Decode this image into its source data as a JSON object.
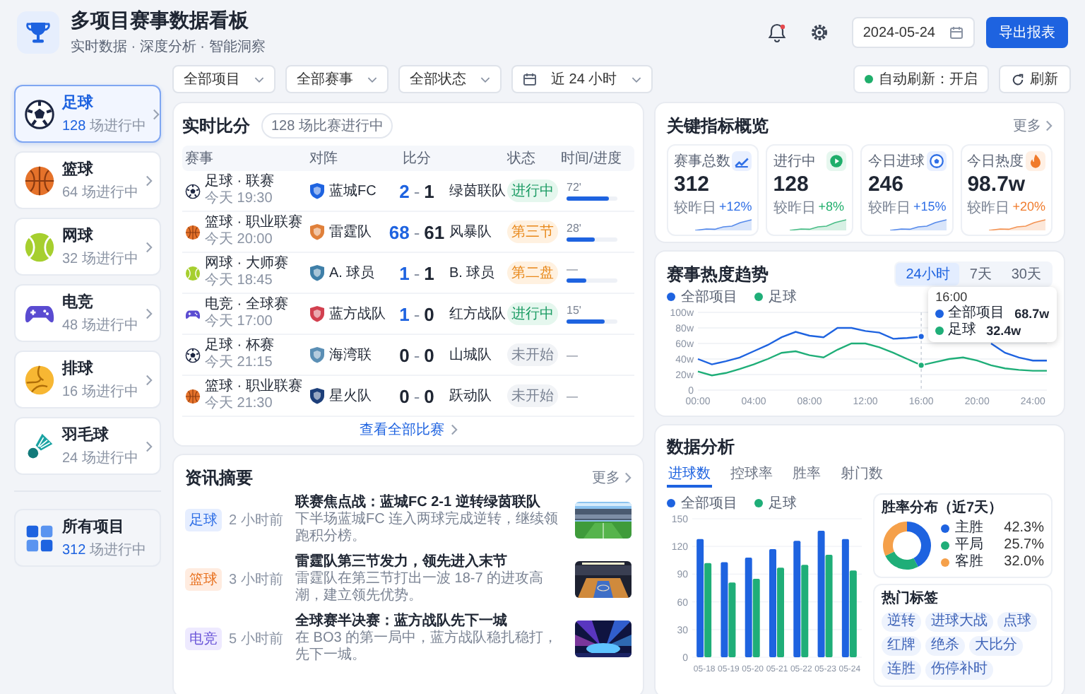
{
  "header": {
    "title": "多项目赛事数据看板",
    "subtitle": "实时数据 · 深度分析 · 智能洞察",
    "date": "2024-05-24",
    "export_button": "导出报表"
  },
  "filters": [
    {
      "label": "全部项目",
      "kind": "select"
    },
    {
      "label": "全部赛事",
      "kind": "select"
    },
    {
      "label": "全部状态",
      "kind": "select"
    },
    {
      "label": "近 24 小时",
      "kind": "date"
    }
  ],
  "auto_refresh": {
    "label": "自动刷新：开启",
    "on": true
  },
  "refresh_button": "刷新",
  "sports": [
    {
      "name": "足球",
      "count": "128",
      "suffix": "场进行中",
      "kind": "football",
      "selected": true
    },
    {
      "name": "篮球",
      "count": "64",
      "suffix": "场进行中",
      "kind": "basketball",
      "selected": false
    },
    {
      "name": "网球",
      "count": "32",
      "suffix": "场进行中",
      "kind": "tennis",
      "selected": false
    },
    {
      "name": "电竞",
      "count": "48",
      "suffix": "场进行中",
      "kind": "esports",
      "selected": false
    },
    {
      "name": "排球",
      "count": "16",
      "suffix": "场进行中",
      "kind": "volleyball",
      "selected": false
    },
    {
      "name": "羽毛球",
      "count": "24",
      "suffix": "场进行中",
      "kind": "badminton",
      "selected": false
    }
  ],
  "all_sports": {
    "name": "所有项目",
    "count": "312",
    "suffix": "场进行中"
  },
  "live": {
    "title": "实时比分",
    "badge": "128 场比赛进行中",
    "columns": [
      "赛事",
      "对阵",
      "比分",
      "状态",
      "时间/进度"
    ],
    "rows": [
      {
        "kind": "football",
        "competition": "足球 · 联赛",
        "time": "今天 19:30",
        "home": {
          "name": "蓝城FC",
          "color": "#1e63e0"
        },
        "home_score": "2",
        "separator": "-",
        "away_score": "1",
        "away": "绿茵联队",
        "status": {
          "label": "进行中",
          "kind": "live"
        },
        "progress": "72'",
        "level": 0.82
      },
      {
        "kind": "basketball",
        "competition": "篮球 · 职业联赛",
        "time": "今天 20:00",
        "home": {
          "name": "雷霆队",
          "color": "#e0803a"
        },
        "home_score": "68",
        "separator": "-",
        "away_score": "61",
        "away": "风暴队",
        "status": {
          "label": "第三节",
          "kind": "period"
        },
        "progress": "28'",
        "level": 0.55
      },
      {
        "kind": "tennis",
        "competition": "网球 · 大师赛",
        "time": "今天 18:45",
        "home": {
          "name": "A. 球员",
          "color": "#3f7fa8"
        },
        "home_score": "1",
        "separator": "-",
        "away_score": "1",
        "away": "B. 球员",
        "status": {
          "label": "第二盘",
          "kind": "period"
        },
        "progress": "—",
        "level": 0.38
      },
      {
        "kind": "esports",
        "competition": "电竞 · 全球赛",
        "time": "今天 17:00",
        "home": {
          "name": "蓝方战队",
          "color": "#d2404f"
        },
        "home_score": "1",
        "separator": "-",
        "away_score": "0",
        "away": "红方战队",
        "status": {
          "label": "进行中",
          "kind": "live"
        },
        "progress": "15'",
        "level": 0.75
      },
      {
        "kind": "football",
        "competition": "足球 · 杯赛",
        "time": "今天 21:15",
        "home": {
          "name": "海湾联",
          "color": "#5b8fb5"
        },
        "home_score": "0",
        "separator": "-",
        "away_score": "0",
        "away": "山城队",
        "status": {
          "label": "未开始",
          "kind": "upcoming"
        },
        "progress": "—"
      },
      {
        "kind": "basketball",
        "competition": "篮球 · 职业联赛",
        "time": "今天 21:30",
        "home": {
          "name": "星火队",
          "color": "#1d3f7a"
        },
        "home_score": "0",
        "separator": "-",
        "away_score": "0",
        "away": "跃动队",
        "status": {
          "label": "未开始",
          "kind": "upcoming"
        },
        "progress": "—"
      }
    ],
    "view_all": "查看全部比赛"
  },
  "news": {
    "title": "资讯摘要",
    "more": "更多",
    "items": [
      {
        "tag": "足球",
        "kind": "football",
        "time": "2 小时前",
        "headline": "联赛焦点战：蓝城FC 2-1 逆转绿茵联队",
        "summary": "下半场蓝城FC 连入两球完成逆转，继续领跑积分榜。"
      },
      {
        "tag": "篮球",
        "kind": "basketball",
        "time": "3 小时前",
        "headline": "雷霆队第三节发力，领先进入末节",
        "summary": "雷霆队在第三节打出一波 18-7 的进攻高潮，建立领先优势。"
      },
      {
        "tag": "电竞",
        "kind": "esports",
        "time": "5 小时前",
        "headline": "全球赛半决赛：蓝方战队先下一城",
        "summary": "在 BO3 的第一局中，蓝方战队稳扎稳打，先下一城。"
      }
    ]
  },
  "kpi": {
    "title": "关键指标概览",
    "more": "更多",
    "cards": [
      {
        "label": "赛事总数",
        "value": "312",
        "compare": "较昨日",
        "delta": "+12%",
        "kind": "total"
      },
      {
        "label": "进行中",
        "value": "128",
        "compare": "较昨日",
        "delta": "+8%",
        "kind": "live"
      },
      {
        "label": "今日进球",
        "value": "246",
        "compare": "较昨日",
        "delta": "+15%",
        "kind": "goals"
      },
      {
        "label": "今日热度",
        "value": "98.7w",
        "compare": "较昨日",
        "delta": "+20%",
        "kind": "heat"
      }
    ]
  },
  "trend": {
    "title": "赛事热度趋势",
    "ranges": [
      {
        "label": "24小时",
        "selected": true
      },
      {
        "label": "7天",
        "selected": false
      },
      {
        "label": "30天",
        "selected": false
      }
    ],
    "chart_data": {
      "type": "line",
      "x": [
        0,
        1,
        2,
        3,
        4,
        5,
        6,
        7,
        8,
        9,
        10,
        11,
        12,
        13,
        14,
        15,
        16,
        17,
        18,
        19,
        20,
        21,
        22,
        23,
        24,
        25
      ],
      "series": [
        {
          "name": "全部项目",
          "color": "#1e63e0",
          "values": [
            40,
            33,
            37,
            42,
            50,
            58,
            68,
            75,
            70,
            68,
            80,
            80,
            76,
            74,
            66,
            67,
            69,
            null,
            null,
            null,
            null,
            60,
            48,
            42,
            38,
            38
          ]
        },
        {
          "name": "足球",
          "color": "#1fae78",
          "values": [
            24,
            19,
            22,
            27,
            33,
            40,
            48,
            50,
            45,
            42,
            52,
            60,
            60,
            55,
            48,
            40,
            32,
            36,
            40,
            42,
            38,
            32,
            28,
            26,
            25,
            25
          ]
        }
      ],
      "xlim": [
        0,
        25
      ],
      "ylim": [
        0,
        100
      ],
      "grid": true,
      "legend": "top",
      "xticks": [
        {
          "value": 0,
          "label": "00:00"
        },
        {
          "value": 4,
          "label": "04:00"
        },
        {
          "value": 8,
          "label": "08:00"
        },
        {
          "value": 12,
          "label": "12:00"
        },
        {
          "value": 16,
          "label": "16:00"
        },
        {
          "value": 20,
          "label": "20:00"
        },
        {
          "value": 24,
          "label": "24:00"
        }
      ],
      "yticks": [
        {
          "value": 0,
          "label": "0"
        },
        {
          "value": 20,
          "label": "20w"
        },
        {
          "value": 40,
          "label": "40w"
        },
        {
          "value": 60,
          "label": "60w"
        },
        {
          "value": 80,
          "label": "80w"
        },
        {
          "value": 100,
          "label": "100w"
        }
      ],
      "ref_lines": [
        {
          "axis": "x",
          "value": 16
        }
      ],
      "annotations": [
        {
          "x": 16,
          "y": 69,
          "text": "16:00"
        }
      ]
    },
    "tooltip": {
      "rows": [
        {
          "label": "全部项目",
          "value": "68.7w"
        },
        {
          "label": "足球",
          "value": "32.4w"
        }
      ]
    }
  },
  "analysis": {
    "title": "数据分析",
    "tabs": [
      {
        "label": "进球数",
        "selected": true
      },
      {
        "label": "控球率",
        "selected": false
      },
      {
        "label": "胜率",
        "selected": false
      },
      {
        "label": "射门数",
        "selected": false
      }
    ],
    "chart_data": {
      "type": "bar",
      "categories": [
        "05-18",
        "05-19",
        "05-20",
        "05-21",
        "05-22",
        "05-23",
        "05-24"
      ],
      "series": [
        {
          "name": "全部项目",
          "color": "#1e63e0",
          "values": [
            128,
            103,
            108,
            117,
            126,
            137,
            128
          ]
        },
        {
          "name": "足球",
          "color": "#1fae78",
          "values": [
            102,
            81,
            85,
            97,
            100,
            111,
            94
          ]
        }
      ],
      "ylim": [
        0,
        150
      ],
      "yticks": [
        0,
        30,
        60,
        90,
        120,
        150
      ],
      "grid": true,
      "legend": "top"
    },
    "win_rate": {
      "chart_data": {
        "type": "donut",
        "title": "胜率分布（近7天）",
        "categories": [
          "主胜",
          "平局",
          "客胜"
        ],
        "values": [
          42.3,
          25.7,
          32.0
        ],
        "legend": "right"
      },
      "legend": [
        {
          "value": "42.3%",
          "color": "#1e63e0"
        },
        {
          "value": "25.7%",
          "color": "#1fae78"
        },
        {
          "value": "32.0%",
          "color": "#f5a04a"
        }
      ]
    },
    "hot_tags": {
      "title": "热门标签",
      "tags": [
        "逆转",
        "进球大战",
        "点球",
        "红牌",
        "绝杀",
        "大比分",
        "连胜",
        "伤停补时"
      ]
    }
  }
}
